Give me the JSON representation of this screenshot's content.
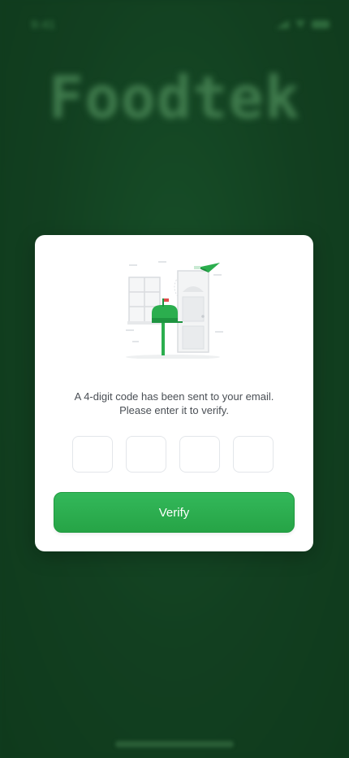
{
  "status_bar": {
    "time": "9:41"
  },
  "background": {
    "brand_name": "Foodtek"
  },
  "modal": {
    "message_line1": "A 4-digit code has been sent to your email.",
    "message_line2": "Please enter it to verify.",
    "otp": {
      "digits": [
        "",
        "",
        "",
        ""
      ]
    },
    "verify_label": "Verify",
    "illustration": "mailbox-door-illustration"
  },
  "colors": {
    "backdrop": "#103d1e",
    "accent_green": "#2bae4e",
    "modal_bg": "#ffffff",
    "text_gray": "#4a4f55"
  }
}
